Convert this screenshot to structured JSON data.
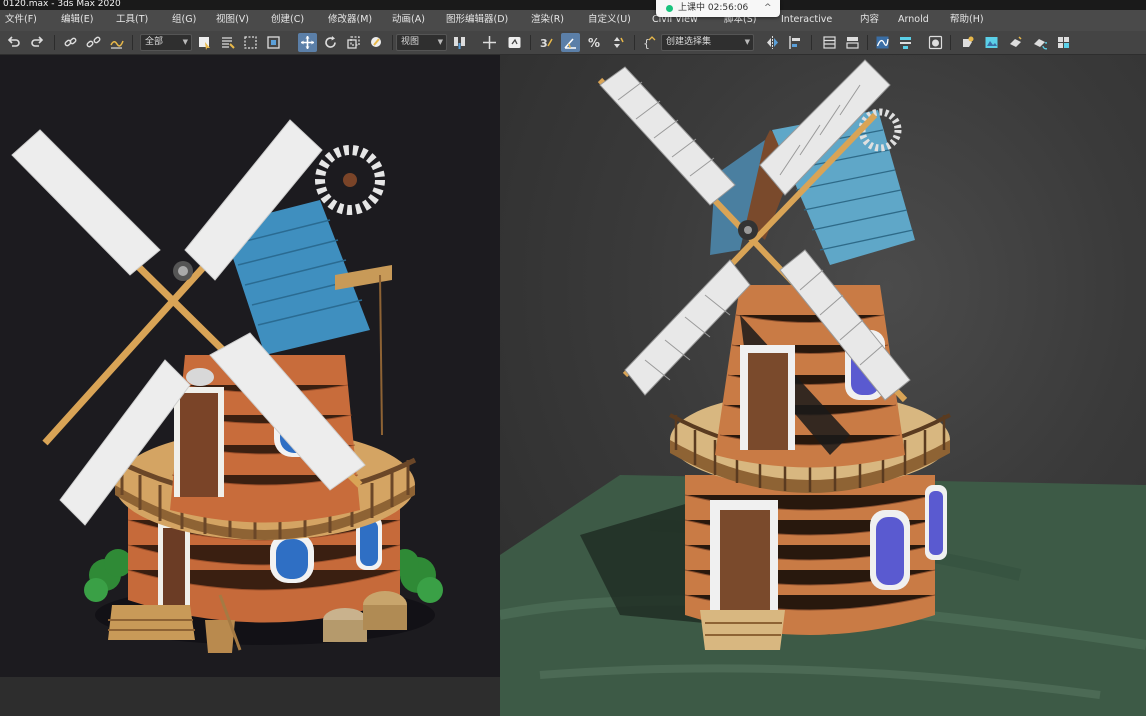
{
  "window": {
    "title": "0120.max - 3ds Max 2020"
  },
  "recording": {
    "text": "上课中 02:56:06",
    "chevron": "^"
  },
  "menu": {
    "items": [
      "文件(F)",
      "编辑(E)",
      "工具(T)",
      "组(G)",
      "视图(V)",
      "创建(C)",
      "修改器(M)",
      "动画(A)",
      "图形编辑器(D)",
      "渲染(R)",
      "自定义(U)",
      "Civil View",
      "脚本(S)",
      "Interactive",
      "内容",
      "Arnold",
      "帮助(H)"
    ]
  },
  "toolbar": {
    "selection_filter": "全部",
    "reference_coord": "视图",
    "named_selection": "创建选择集",
    "icons": [
      "undo-icon",
      "redo-icon",
      "link-icon",
      "unlink-icon",
      "bind-spacewarp-icon",
      "select-object-icon",
      "select-by-name-icon",
      "rect-selection-icon",
      "window-crossing-icon",
      "move-icon",
      "rotate-icon",
      "scale-icon",
      "select-place-icon",
      "use-pivot-icon",
      "keyboard-shortcut-icon",
      "snap-3d-icon",
      "angle-snap-icon",
      "percent-snap-icon",
      "spinner-snap-icon",
      "edit-named-selection-icon",
      "mirror-icon",
      "align-icon",
      "layer-explorer-icon",
      "toggle-ribbon-icon",
      "curve-editor-icon",
      "schematic-view-icon",
      "material-editor-icon",
      "render-setup-icon",
      "rendered-frame-icon",
      "render-production-icon",
      "render-iterative-icon",
      "render-cloud-icon",
      "open-a360-icon"
    ]
  },
  "colors": {
    "accent_title": "#c4155a",
    "active_tool": "#5b7fa8",
    "menubar": "#4a4a4a",
    "toolbar": "#444444"
  },
  "viewports": {
    "left": {
      "content": "windmill-concept-image"
    },
    "right": {
      "content": "windmill-3d-model-viewport"
    }
  }
}
